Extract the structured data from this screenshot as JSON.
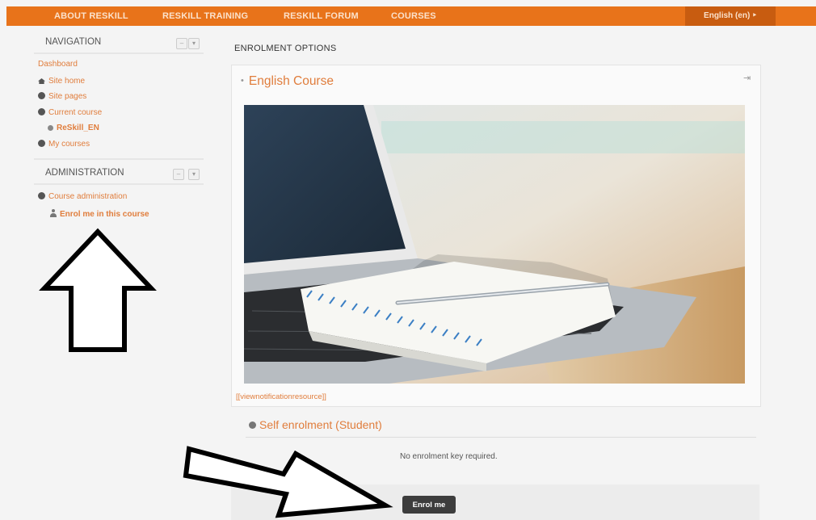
{
  "topnav": {
    "items": [
      "ABOUT RESKILL",
      "RESKILL TRAINING",
      "RESKILL FORUM",
      "COURSES"
    ],
    "language": "English (en) ‣"
  },
  "navigation": {
    "title": "NAVIGATION",
    "dashboard": "Dashboard",
    "site_home": "Site home",
    "site_pages": "Site pages",
    "current_course": "Current course",
    "course_short": "ReSkill_EN",
    "my_courses": "My courses"
  },
  "administration": {
    "title": "ADMINISTRATION",
    "course_admin": "Course administration",
    "enrol_link": "Enrol me in this course"
  },
  "main": {
    "heading": "ENROLMENT OPTIONS",
    "course_title": "English Course",
    "notification_link": "[[viewnotificationresource]]",
    "self_enrol_title": "Self enrolment (Student)",
    "no_key_text": "No enrolment key required.",
    "enrol_button": "Enrol me"
  },
  "colors": {
    "accent": "#e8731a",
    "link": "#e07d3c",
    "button": "#3d3d3d"
  },
  "icons": {
    "block_controls": [
      "minus",
      "gear"
    ],
    "nav_bullet": "circle-bullet",
    "home": "home-icon",
    "user": "user-icon",
    "enter": "enter-icon"
  }
}
